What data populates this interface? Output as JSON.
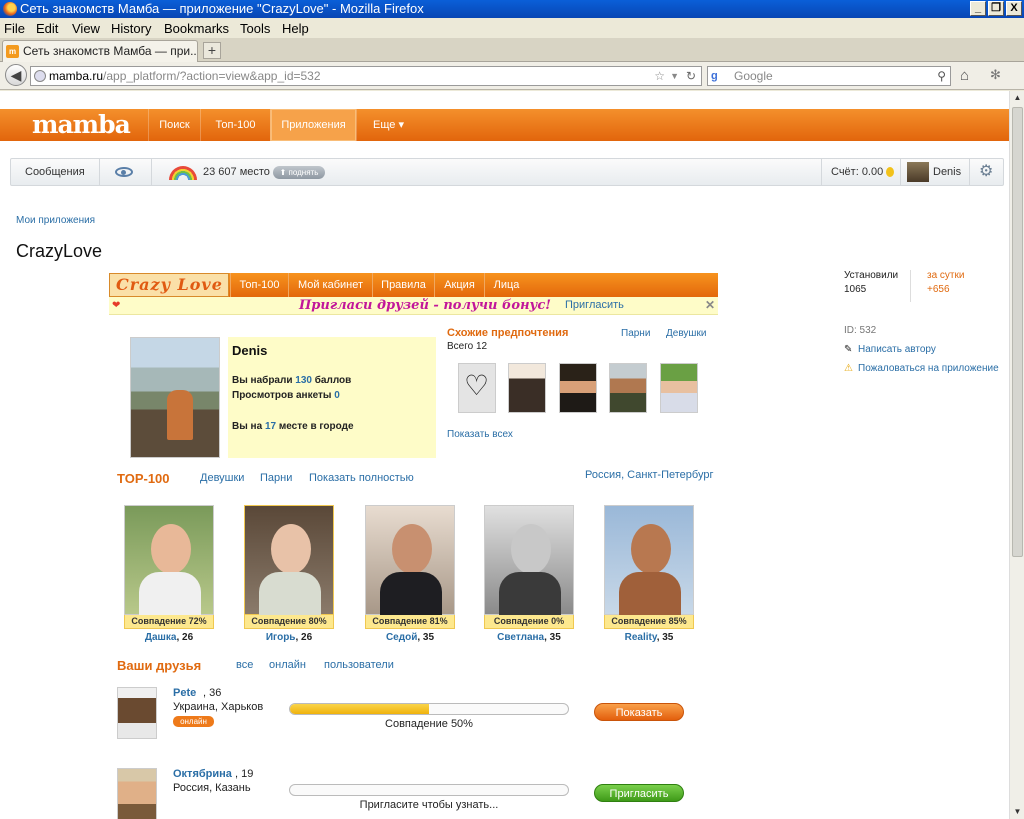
{
  "window": {
    "title": "Сеть знакомств Мамба — приложение \"CrazyLove\" - Mozilla Firefox",
    "buttons": [
      "_",
      "❐",
      "X"
    ]
  },
  "menu": [
    "File",
    "Edit",
    "View",
    "History",
    "Bookmarks",
    "Tools",
    "Help"
  ],
  "tab": {
    "label": "Сеть знакомств Мамба — при...",
    "new_tab": "+"
  },
  "nav": {
    "url_host": "mamba.ru",
    "url_path": "/app_platform/?action=view&app_id=532",
    "search_placeholder": "Google"
  },
  "site": {
    "logo": "mamba",
    "nav": [
      "Поиск",
      "Топ-100",
      "Приложения",
      "Еще ▾"
    ],
    "active_nav": "Приложения",
    "userbar": {
      "messages": "Сообщения",
      "rank": "23 607 место",
      "raise": "поднять",
      "balance": "Счёт: 0.00",
      "user": "Denis"
    },
    "breadcrumb": "Мои приложения",
    "page_title": "CrazyLove",
    "info": {
      "installed_label": "Установили",
      "installed_value": "1065",
      "daily_label": "за сутки",
      "daily_value": "+656",
      "id": "ID: 532",
      "write_author": "Написать автору",
      "complain": "Пожаловаться на приложение"
    }
  },
  "app": {
    "logo": "Crazy Love",
    "tabs": [
      "Топ-100",
      "Мой кабинет",
      "Правила",
      "Акция",
      "Лица"
    ],
    "promo": {
      "text": "Пригласи друзей - получи бонус!",
      "invite": "Пригласить",
      "close": "✕"
    },
    "profile": {
      "name": "Denis",
      "score_prefix": "Вы набрали",
      "score": "130",
      "score_suffix": "баллов",
      "views_prefix": "Просмотров анкеты",
      "views": "0",
      "place_prefix": "Вы на",
      "place": "17",
      "place_suffix": "месте в городе"
    },
    "similar": {
      "title": "Схожие предпочтения",
      "boys": "Парни",
      "girls": "Девушки",
      "total": "Всего 12",
      "show_all": "Показать всех"
    },
    "top100": {
      "title": "TOP-100",
      "girls": "Девушки",
      "boys": "Парни",
      "show_full": "Показать полностью",
      "region": "Россия, Санкт-Петербург",
      "cards": [
        {
          "name": "Дашка",
          "age": ", 26",
          "match": "Совпадение 72%"
        },
        {
          "name": "Игорь",
          "age": ", 26",
          "match": "Совпадение 80%"
        },
        {
          "name": "Седой",
          "age": ", 35",
          "match": "Совпадение 81%"
        },
        {
          "name": "Светлана",
          "age": ", 35",
          "match": "Совпадение 0%"
        },
        {
          "name": "Reality",
          "age": ", 35",
          "match": "Совпадение 85%"
        }
      ]
    },
    "friends": {
      "title": "Ваши друзья",
      "all": "все",
      "online": "онлайн",
      "users": "пользователи",
      "list": [
        {
          "name": "Pete",
          "age": ", 36",
          "city": "Украина, Харьков",
          "status": "онлайн",
          "progress_label": "Совпадение 50%",
          "progress": 0.5,
          "action": "Показать"
        },
        {
          "name": "Октябрина",
          "age": ", 19",
          "city": "Россия, Казань",
          "progress_label": "Пригласите чтобы узнать...",
          "progress": 0,
          "action": "Пригласить"
        }
      ]
    }
  }
}
